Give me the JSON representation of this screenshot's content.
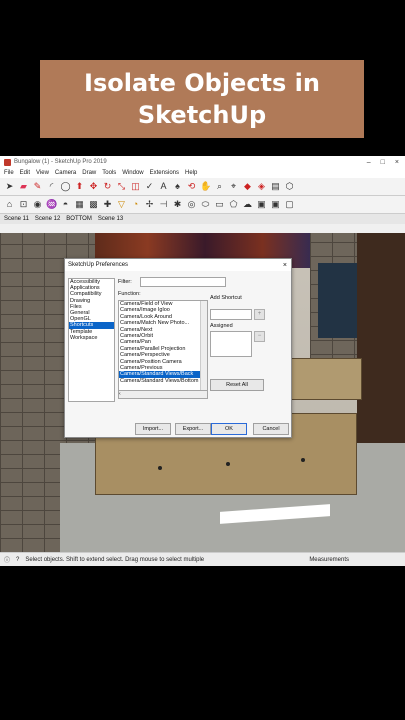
{
  "banner": {
    "line1": "Isolate Objects in",
    "line2": "SketchUp"
  },
  "app": {
    "window_title": "Bungalow (1) - SketchUp Pro 2019",
    "menu": [
      "File",
      "Edit",
      "View",
      "Camera",
      "Draw",
      "Tools",
      "Window",
      "Extensions",
      "Help"
    ],
    "scenes": [
      "Scene 11",
      "Scene 12",
      "BOTTOM",
      "Scene 13"
    ],
    "status_text": "Select objects. Shift to extend select. Drag mouse to select multiple",
    "measurements_label": "Measurements"
  },
  "dialog": {
    "title": "SketchUp Preferences",
    "categories": [
      "Accessibility",
      "Applications",
      "Compatibility",
      "Drawing",
      "Files",
      "General",
      "OpenGL",
      "Shortcuts",
      "Template",
      "Workspace"
    ],
    "selected_category": "Shortcuts",
    "filter_label": "Filter:",
    "function_label": "Function:",
    "add_shortcut_label": "Add Shortcut",
    "assigned_label": "Assigned",
    "functions": [
      "Camera/Field of View",
      "Camera/Image Igloo",
      "Camera/Look Around",
      "Camera/Match New Photo...",
      "Camera/Next",
      "Camera/Orbit",
      "Camera/Pan",
      "Camera/Parallel Projection",
      "Camera/Perspective",
      "Camera/Position Camera",
      "Camera/Previous",
      "Camera/Standard Views/Back",
      "Camera/Standard Views/Bottom"
    ],
    "selected_function": "Camera/Standard Views/Back",
    "reset_all": "Reset All",
    "import": "Import...",
    "export": "Export...",
    "ok": "OK",
    "cancel": "Cancel"
  },
  "colors": {
    "banner_bg": "#b07a58",
    "selection": "#0a64c8"
  }
}
